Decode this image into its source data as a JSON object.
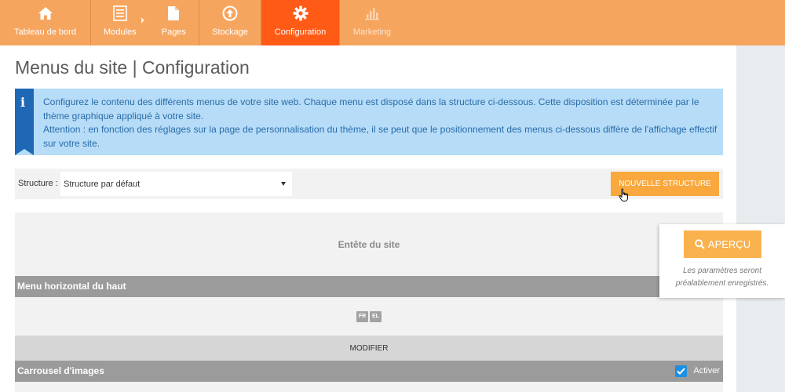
{
  "nav": {
    "items": [
      {
        "label": "Tableau de bord",
        "icon": "home-icon"
      },
      {
        "label": "Modules",
        "icon": "list-icon"
      },
      {
        "label": "Pages",
        "icon": "page-icon"
      },
      {
        "label": "Stockage",
        "icon": "upload-icon"
      },
      {
        "label": "Configuration",
        "icon": "gear-icon"
      },
      {
        "label": "Marketing",
        "icon": "bar-chart-icon"
      }
    ],
    "active": "Configuration",
    "colors": {
      "bar": "#f6a55f",
      "active": "#ff5b17"
    }
  },
  "page": {
    "title": "Menus du site | Configuration"
  },
  "info": {
    "icon": "info-icon",
    "lines": [
      "Configurez le contenu des différents menus de votre site web. Chaque menu est disposé dans la structure ci-dessous. Cette disposition est déterminée par le thème graphique appliqué à votre site.",
      "Attention : en fonction des réglages sur la page de personnalisation du thème, il se peut que le positionnement des menus ci-dessous diffère de l'affichage effectif sur votre site."
    ]
  },
  "structure": {
    "label": "Structure :",
    "selected": "Structure par défaut",
    "new_button": "NOUVELLE STRUCTURE"
  },
  "layout": {
    "header_label": "Entête du site",
    "menu_bar": "Menu horizontal du haut",
    "languages": [
      "FR",
      "EL"
    ],
    "modify_button": "MODIFIER",
    "carousel_bar": "Carrousel d'images",
    "activate_label": "Activer",
    "activate_checked": true
  },
  "preview": {
    "button": "APERÇU",
    "note_line1": "Les paramètres seront",
    "note_line2": "préalablement enregistrés."
  }
}
